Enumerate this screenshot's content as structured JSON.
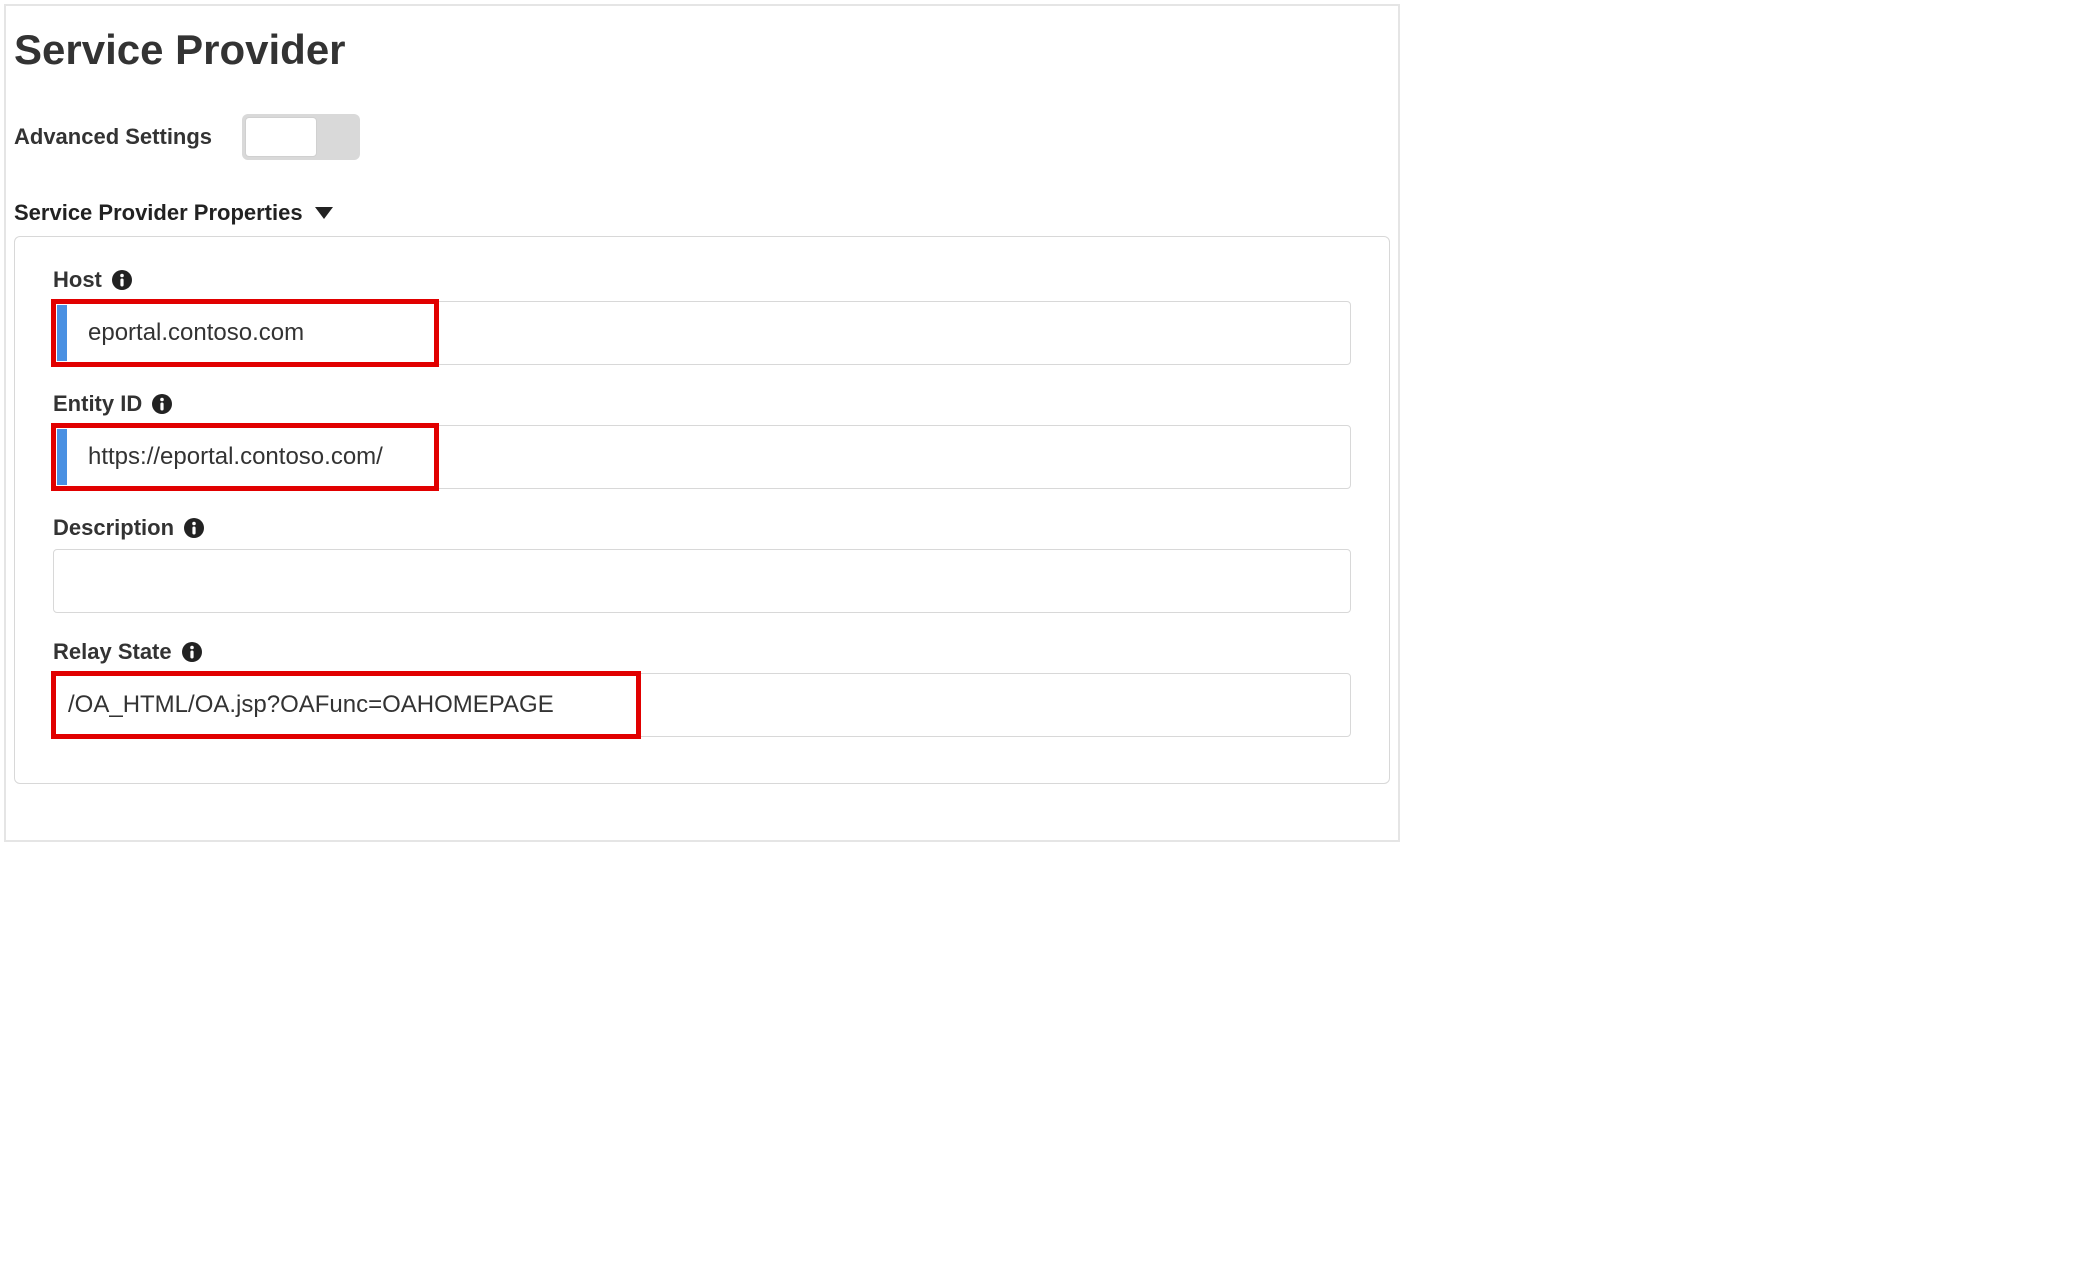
{
  "pageTitle": "Service Provider",
  "advancedSettingsLabel": "Advanced Settings",
  "advancedSettingsOn": false,
  "sectionTitle": "Service Provider Properties",
  "fields": {
    "host": {
      "label": "Host",
      "value": "eportal.contoso.com"
    },
    "entityId": {
      "label": "Entity ID",
      "value": "https://eportal.contoso.com/"
    },
    "description": {
      "label": "Description",
      "value": ""
    },
    "relayState": {
      "label": "Relay State",
      "value": "/OA_HTML/OA.jsp?OAFunc=OAHOMEPAGE"
    }
  }
}
